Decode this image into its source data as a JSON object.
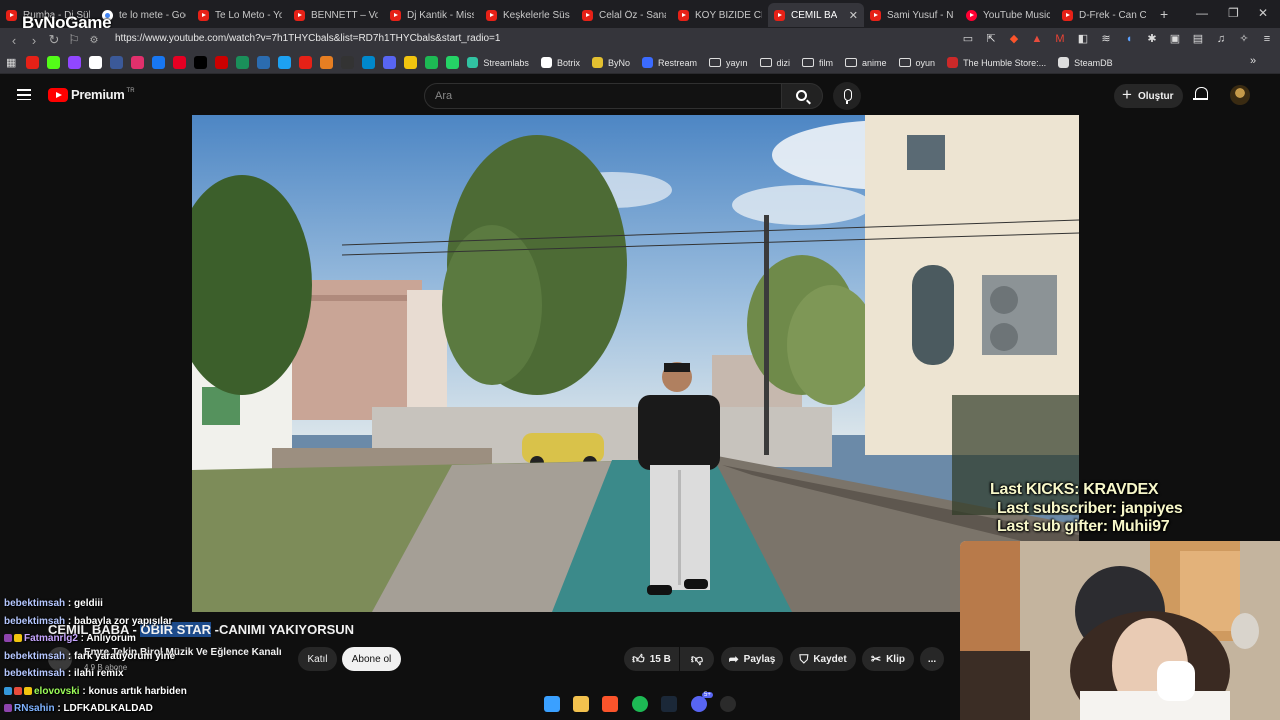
{
  "browser": {
    "logo_overlay": "ByNoGame",
    "tabs": [
      {
        "title": "Rumba - Dj Süley",
        "favicon": "youtube"
      },
      {
        "title": "te lo mete - Goog",
        "favicon": "google"
      },
      {
        "title": "Te Lo Meto - You",
        "favicon": "youtube"
      },
      {
        "title": "BENNETT – Vois s",
        "favicon": "youtube"
      },
      {
        "title": "Dj Kantik - Miss S",
        "favicon": "youtube"
      },
      {
        "title": "Keşkelerle Süsler",
        "favicon": "youtube"
      },
      {
        "title": "Celal Öz - Sana G",
        "favicon": "youtube"
      },
      {
        "title": "KOY BİZİDE CENN",
        "favicon": "youtube"
      },
      {
        "title": "CEMİL BA",
        "favicon": "youtube",
        "active": true
      },
      {
        "title": "Sami Yusuf - Nası",
        "favicon": "youtube"
      },
      {
        "title": "YouTube Music",
        "favicon": "youtube-music"
      },
      {
        "title": "D-Frek - Can Can",
        "favicon": "youtube"
      }
    ],
    "new_tab": "+",
    "url": "https://www.youtube.com/watch?v=7h1THYCbals&list=RD7h1THYCbals&start_radio=1",
    "bookmarks": [
      {
        "label": "Streamlabs",
        "color": "#31c3a2"
      },
      {
        "label": "Botrix",
        "color": "#ffffff"
      },
      {
        "label": "ByNo",
        "color": "#e3c030"
      },
      {
        "label": "Restream",
        "color": "#3b6bff"
      },
      {
        "label": "yayın",
        "folder": true
      },
      {
        "label": "dizi",
        "folder": true
      },
      {
        "label": "film",
        "folder": true
      },
      {
        "label": "anime",
        "folder": true
      },
      {
        "label": "oyun",
        "folder": true
      },
      {
        "label": "The Humble Store:...",
        "color": "#cc2929"
      },
      {
        "label": "SteamDB",
        "color": "#dddddd"
      }
    ],
    "bookmark_icon_colors": [
      "#e62117",
      "#53fc18",
      "#9147ff",
      "#ffffff",
      "#3b5998",
      "#e1306c",
      "#1877f2",
      "#e60023",
      "#000000",
      "#cc0000",
      "#1a8f5a",
      "#2b6cb0",
      "#1da1f2",
      "#e62117",
      "#e67e22",
      "#333333",
      "#0088cc",
      "#5865f2",
      "#f1c40f",
      "#1db954",
      "#25d366"
    ]
  },
  "youtube": {
    "logo_text": "Premium",
    "logo_sup": "TR",
    "search_placeholder": "Ara",
    "create_label": "Oluştur"
  },
  "video": {
    "title_prefix": "CEMİL BABA -",
    "title_highlight": "OBIR STAR",
    "title_suffix": "-CANIMI YAKIYORSUN",
    "channel_name": "Emre Tekin Birol Müzik Ve Eğlence Kanalı",
    "channel_subs": "4,9 B abone",
    "join_label": "Katıl",
    "subscribe_label": "Abone ol",
    "likes": "15 B",
    "share_label": "Paylaş",
    "save_label": "Kaydet",
    "clip_label": "Klip",
    "more": "..."
  },
  "stream_overlay": {
    "last_kicks": "Last KICKS: KRAVDEX",
    "last_subscriber": "Last subscriber: janpiyes",
    "last_sub_gifter": "Last sub gifter: Muhii97"
  },
  "chat": [
    {
      "user": "bebektimsah",
      "msg": "geldiii",
      "color": "#b5c7ff"
    },
    {
      "user": "bebektimsah",
      "msg": "babayla zor yapışılar",
      "color": "#b5c7ff"
    },
    {
      "user": "Fatmanrlg2",
      "msg": "Anlıyorum",
      "color": "#c7a6ff",
      "badges": [
        "#8e44ad",
        "#f1c40f"
      ]
    },
    {
      "user": "bebektimsah",
      "msg": "fark yaratıyorum yine",
      "color": "#b5c7ff"
    },
    {
      "user": "bebektimsah",
      "msg": "ilahi remix",
      "color": "#b5c7ff"
    },
    {
      "user": "elovovski",
      "msg": "konus artık harbiden",
      "color": "#9dff5a",
      "badges": [
        "#3498db",
        "#e74c3c",
        "#f1c40f"
      ]
    },
    {
      "user": "RNsahin",
      "msg": "LDFKADLKALDAD",
      "color": "#7fb3ff",
      "badges": [
        "#8e44ad"
      ]
    }
  ],
  "taskbar": [
    {
      "name": "windows-start-icon",
      "color": "#3aa0ff"
    },
    {
      "name": "file-explorer-icon",
      "color": "#f2c14e"
    },
    {
      "name": "brave-icon",
      "color": "#fb542b"
    },
    {
      "name": "spotify-icon",
      "color": "#1db954"
    },
    {
      "name": "steam-icon",
      "color": "#1b2838"
    },
    {
      "name": "discord-icon",
      "color": "#5865f2"
    },
    {
      "name": "obs-icon",
      "color": "#2b2b2b"
    }
  ],
  "taskbar_discord_badge": "5+"
}
